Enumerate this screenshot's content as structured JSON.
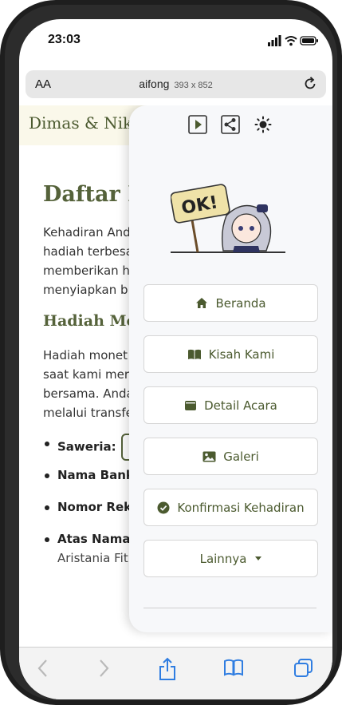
{
  "status": {
    "time": "23:03"
  },
  "browser": {
    "aa_label": "AA",
    "host": "aifong",
    "dimensions": "393 x 852"
  },
  "site": {
    "brand": "Dimas & Nike"
  },
  "article": {
    "heading": "Daftar H",
    "intro": [
      "Kehadiran And",
      "hadiah terbesa",
      "memberikan h",
      "menyiapkan b"
    ],
    "subheading": "Hadiah Mon",
    "body": [
      "Hadiah monet",
      "saat kami mer",
      "bersama. Anda",
      "melalui transfe"
    ],
    "list": [
      {
        "label": "Saweria:"
      },
      {
        "label": "Nama Bank"
      },
      {
        "label": "Nomor Rek"
      },
      {
        "label": "Atas Nama:",
        "sub": "Aristania Fit"
      }
    ]
  },
  "menu": {
    "topicons": [
      "play-icon",
      "share-icon",
      "sun-icon"
    ],
    "mascot_text": "OK!",
    "items": [
      {
        "label": "Beranda",
        "icon": "house-icon"
      },
      {
        "label": "Kisah Kami",
        "icon": "book-icon"
      },
      {
        "label": "Detail Acara",
        "icon": "wallet-icon"
      },
      {
        "label": "Galeri",
        "icon": "image-icon"
      },
      {
        "label": "Konfirmasi Kehadiran",
        "icon": "check-circle-icon"
      },
      {
        "label": "Lainnya",
        "icon": "caret-down-icon"
      }
    ],
    "accent_color": "#4b5a2f"
  },
  "toolbar": {
    "items": [
      "back-icon",
      "forward-icon",
      "share-icon",
      "bookmarks-icon",
      "tabs-icon"
    ]
  }
}
